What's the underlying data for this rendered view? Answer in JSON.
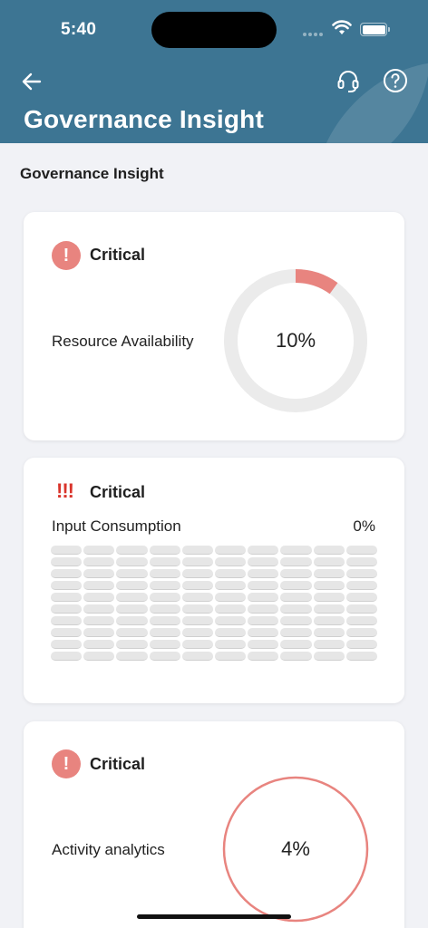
{
  "status_bar": {
    "time": "5:40"
  },
  "header": {
    "title": "Governance Insight",
    "back_icon": "arrow-left-icon",
    "support_icon": "headset-icon",
    "help_icon": "question-circle-icon"
  },
  "section": {
    "title": "Governance Insight"
  },
  "cards": [
    {
      "status": "Critical",
      "icon": "exclamation-circle-icon",
      "label": "Resource Availability",
      "value": "10%",
      "progress": 0.1
    },
    {
      "status": "Critical",
      "icon": "triple-exclamation-icon",
      "label": "Input Consumption",
      "value": "0%",
      "progress": 0.0
    },
    {
      "status": "Critical",
      "icon": "exclamation-circle-icon",
      "label": "Activity analytics",
      "value": "4%",
      "progress": 0.04
    }
  ],
  "colors": {
    "header_bg": "#3d7593",
    "critical": "#e8847f",
    "critical_dark": "#d9342b",
    "track": "#ebebeb",
    "background": "#f1f2f6"
  }
}
